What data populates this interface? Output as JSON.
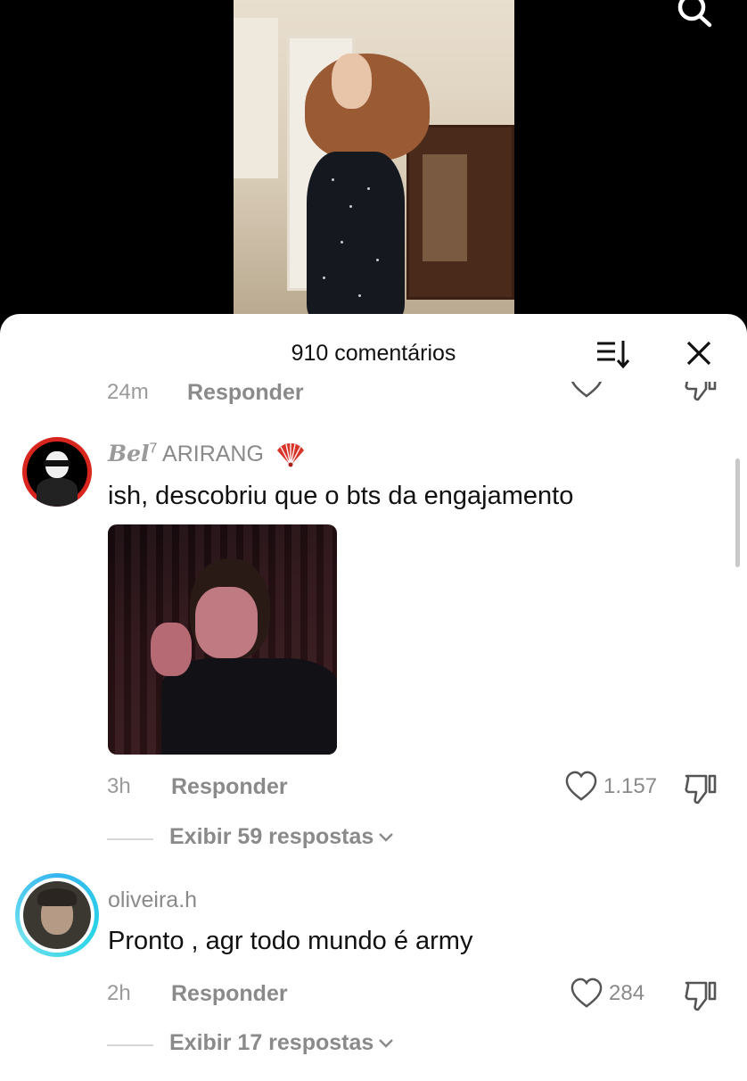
{
  "sheet": {
    "title": "910 comentários"
  },
  "partial_comment": {
    "time": "24m",
    "reply_label": "Responder"
  },
  "comments": [
    {
      "username_styled": "Bel",
      "username_sup": "7",
      "username_rest": "ARIRANG",
      "text": "ish, descobriu que o bts da engajamento",
      "time": "3h",
      "reply_label": "Responder",
      "likes": "1.157",
      "replies_label": "Exibir 59 respostas"
    },
    {
      "username": "oliveira.h",
      "text": "Pronto , agr todo mundo é army",
      "time": "2h",
      "reply_label": "Responder",
      "likes": "284",
      "replies_label": "Exibir 17 respostas"
    }
  ],
  "icons": {
    "search": "search-icon",
    "sort": "sort-icon",
    "close": "close-icon",
    "like": "heart-icon",
    "dislike": "dislike-icon",
    "expand": "chevron-down-icon",
    "fan": "fan-icon"
  },
  "colors": {
    "avatar_ring": "#35b6f0",
    "fan_red": "#d8352a",
    "muted_text": "#8a8a8a"
  }
}
